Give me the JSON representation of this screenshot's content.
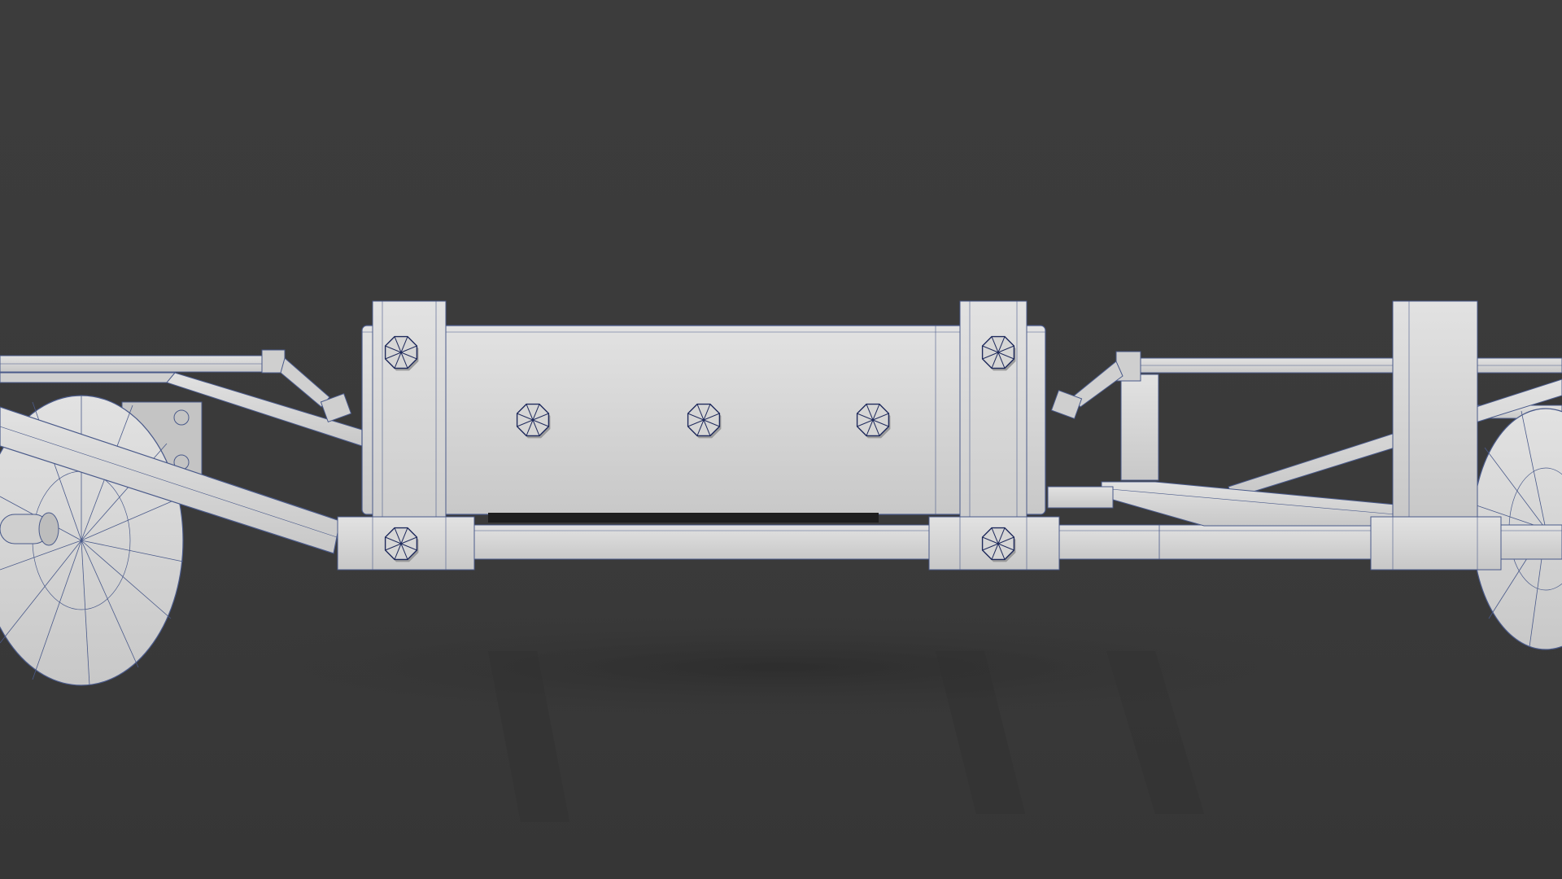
{
  "scene": {
    "subject": "wireframe-render-wooden-cart-chassis",
    "colors": {
      "background": "#3b3b3b",
      "floor": "#383838",
      "shadow": "#2e2e2e",
      "surface": "#d9d9d9",
      "surface_dark": "#bdbdbd",
      "wire": "#4a5a8a",
      "bolt_wire": "#1f2a5c"
    },
    "bolt_count": 7,
    "wheel_count": 2
  }
}
